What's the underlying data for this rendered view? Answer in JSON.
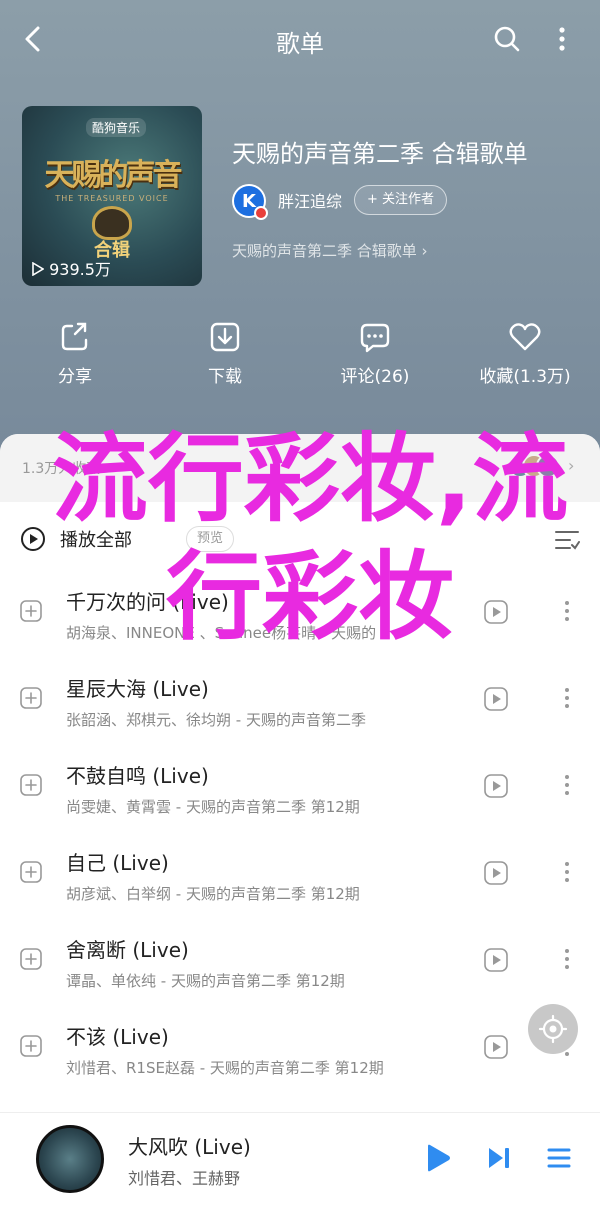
{
  "nav": {
    "title": "歌单"
  },
  "cover": {
    "brand": "酷狗音乐",
    "logo_text": "天赐的声音",
    "logo_sub": "THE TREASURED VOICE",
    "album_label": "合辑",
    "plays": "939.5万"
  },
  "playlist": {
    "title": "天赐的声音第二季 合辑歌单",
    "author_initial": "K",
    "author_name": "胖汪追综",
    "follow_label": "+ 关注作者",
    "description": "天赐的声音第二季 合辑歌单 ›"
  },
  "actions": [
    {
      "label": "分享",
      "icon": "share-icon"
    },
    {
      "label": "下载",
      "icon": "download-icon"
    },
    {
      "label": "评论(26)",
      "icon": "comment-icon"
    },
    {
      "label": "收藏(1.3万)",
      "icon": "heart-icon"
    }
  ],
  "collect_bar": {
    "text": "1.3万人收藏",
    "arrow": "›"
  },
  "list_header": {
    "play_all": "播放全部",
    "preview": "预览"
  },
  "songs": [
    {
      "title": "千万次的问 (Live)",
      "sub": "胡海泉、INNEONE 、Sunnee杨芸晴 - 天赐的"
    },
    {
      "title": "星辰大海 (Live)",
      "sub": "张韶涵、郑棋元、徐均朔 - 天赐的声音第二季"
    },
    {
      "title": "不鼓自鸣 (Live)",
      "sub": "尚雯婕、黄霄雲 - 天赐的声音第二季 第12期"
    },
    {
      "title": "自己 (Live)",
      "sub": "胡彦斌、白举纲 - 天赐的声音第二季 第12期"
    },
    {
      "title": "舍离断 (Live)",
      "sub": "谭晶、单依纯 - 天赐的声音第二季 第12期"
    },
    {
      "title": "不该 (Live)",
      "sub": "刘惜君、R1SE赵磊 - 天赐的声音第二季 第12期"
    }
  ],
  "player": {
    "title": "大风吹 (Live)",
    "artist": "刘惜君、王赫野"
  },
  "watermark": "流行彩妆,流行彩妆",
  "colors": {
    "header_bg": "#8394a1",
    "accent_blue": "#2f8cf0",
    "watermark": "#e82ae0",
    "author_badge": "#e8403b"
  }
}
